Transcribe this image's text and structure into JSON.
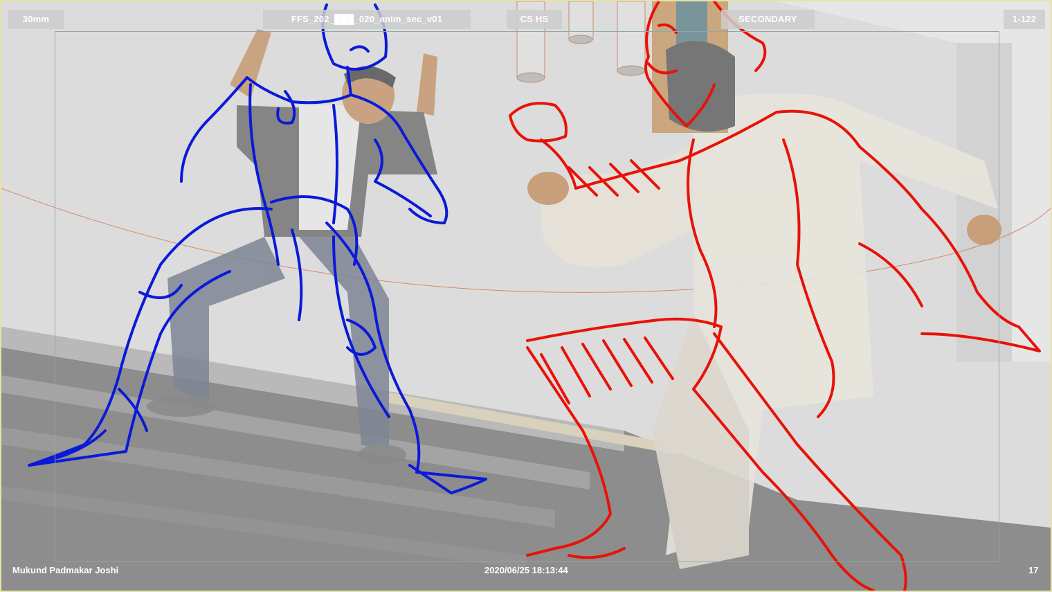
{
  "hud": {
    "focal_length": "30mm",
    "shot_name": "FFS_202_███_020_anim_sec_v01",
    "shot_type": "CS HS",
    "layer": "SECONDARY",
    "frame_range": "1-122",
    "artist": "Mukund Padmakar Joshi",
    "timestamp": "2020/06/25 18:13:44",
    "frame_number": "17"
  },
  "colors": {
    "sketch_left": "#0a1ad8",
    "sketch_right": "#e81208",
    "background": "#d9d9d9",
    "safe_frame": "#8faaa3"
  }
}
